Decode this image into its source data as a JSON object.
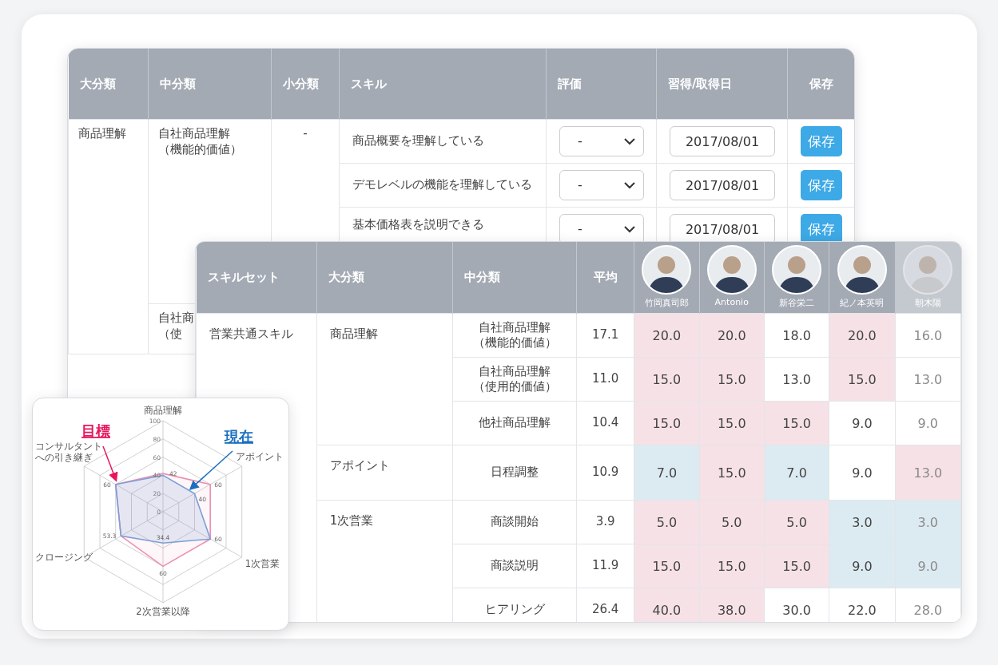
{
  "skill_edit_table": {
    "columns": [
      "大分類",
      "中分類",
      "小分類",
      "スキル",
      "評価",
      "習得/取得日",
      "保存"
    ],
    "rows": [
      {
        "major": "商品理解",
        "mid": [
          "自社商品理解",
          "（機能的価値）"
        ],
        "minor": "-",
        "skill": "商品概要を理解している",
        "rating": "-",
        "date": "2017/08/01",
        "save": "保存"
      },
      {
        "skill": "デモレベルの機能を理解している",
        "rating": "-",
        "date": "2017/08/01",
        "save": "保存"
      },
      {
        "skill": "基本価格表を説明できる",
        "rating": "-",
        "date": "2017/08/01",
        "save": "保存"
      },
      {
        "mid": [
          "自社商",
          "（使"
        ]
      }
    ]
  },
  "skill_matrix": {
    "columns": [
      "スキルセット",
      "大分類",
      "中分類",
      "平均"
    ],
    "people": [
      {
        "name": "竹岡真司郎",
        "faded": false
      },
      {
        "name": "Antonio",
        "faded": false
      },
      {
        "name": "新谷栄二",
        "faded": false
      },
      {
        "name": "紀ノ本英明",
        "faded": false
      },
      {
        "name": "朝木陽",
        "faded": true
      }
    ],
    "rows": [
      {
        "set": "営業共通スキル",
        "major": "商品理解",
        "mid": "自社商品理解（機能的価値）",
        "avg": "17.1",
        "scores": [
          {
            "value": "20.0",
            "color": "#f6e1e6"
          },
          {
            "value": "20.0",
            "color": "#f6e1e6"
          },
          {
            "value": "18.0",
            "color": "#ffffff"
          },
          {
            "value": "20.0",
            "color": "#f6e1e6"
          },
          {
            "value": "16.0",
            "color": "#ffffff"
          }
        ]
      },
      {
        "mid": "自社商品理解（使用的価値）",
        "avg": "11.0",
        "scores": [
          {
            "value": "15.0",
            "color": "#f6e1e6"
          },
          {
            "value": "15.0",
            "color": "#f6e1e6"
          },
          {
            "value": "13.0",
            "color": "#ffffff"
          },
          {
            "value": "15.0",
            "color": "#f6e1e6"
          },
          {
            "value": "13.0",
            "color": "#ffffff"
          }
        ]
      },
      {
        "mid": "他社商品理解",
        "avg": "10.4",
        "scores": [
          {
            "value": "15.0",
            "color": "#f6e1e6"
          },
          {
            "value": "15.0",
            "color": "#f6e1e6"
          },
          {
            "value": "15.0",
            "color": "#f6e1e6"
          },
          {
            "value": "9.0",
            "color": "#ffffff"
          },
          {
            "value": "9.0",
            "color": "#ffffff"
          }
        ]
      },
      {
        "major": "アポイント",
        "mid": "日程調整",
        "avg": "10.9",
        "scores": [
          {
            "value": "7.0",
            "color": "#dcebf1"
          },
          {
            "value": "15.0",
            "color": "#f6e1e6"
          },
          {
            "value": "7.0",
            "color": "#dcebf1"
          },
          {
            "value": "9.0",
            "color": "#ffffff"
          },
          {
            "value": "13.0",
            "color": "#f6e1e6"
          }
        ]
      },
      {
        "major": "1次営業",
        "mid": "商談開始",
        "avg": "3.9",
        "scores": [
          {
            "value": "5.0",
            "color": "#f6e1e6"
          },
          {
            "value": "5.0",
            "color": "#f6e1e6"
          },
          {
            "value": "5.0",
            "color": "#f6e1e6"
          },
          {
            "value": "3.0",
            "color": "#dcebf1"
          },
          {
            "value": "3.0",
            "color": "#dcebf1"
          }
        ]
      },
      {
        "mid": "商談説明",
        "avg": "11.9",
        "scores": [
          {
            "value": "15.0",
            "color": "#f6e1e6"
          },
          {
            "value": "15.0",
            "color": "#f6e1e6"
          },
          {
            "value": "15.0",
            "color": "#f6e1e6"
          },
          {
            "value": "9.0",
            "color": "#dcebf1"
          },
          {
            "value": "9.0",
            "color": "#dcebf1"
          }
        ]
      },
      {
        "mid": "ヒアリング",
        "avg": "26.4",
        "scores": [
          {
            "value": "40.0",
            "color": "#f6e1e6"
          },
          {
            "value": "38.0",
            "color": "#f6e1e6"
          },
          {
            "value": "30.0",
            "color": "#ffffff"
          },
          {
            "value": "22.0",
            "color": "#ffffff"
          },
          {
            "value": "28.0",
            "color": "#ffffff"
          }
        ]
      }
    ]
  },
  "radar_card": {
    "chart_data": {
      "type": "radar",
      "categories": [
        "商品理解",
        "アポイント",
        "1次営業",
        "2次営業以降",
        "クロージング",
        "コンサルタントへの引き継ぎ"
      ],
      "ylim": [
        0,
        100
      ],
      "yticks": [
        0,
        20,
        40,
        60,
        80,
        100
      ],
      "series": [
        {
          "name": "目標",
          "color": "#ee8fb0",
          "values": [
            42,
            60,
            60,
            60,
            53.3,
            60
          ]
        },
        {
          "name": "現在",
          "color": "#7b9fd6",
          "values": [
            40,
            40,
            60,
            34.4,
            53.3,
            60
          ]
        }
      ],
      "value_labels": [
        [
          "42",
          "60",
          "60",
          "60",
          "53.3",
          "60"
        ],
        [
          null,
          "40",
          null,
          "34.4",
          null,
          null
        ]
      ]
    }
  }
}
